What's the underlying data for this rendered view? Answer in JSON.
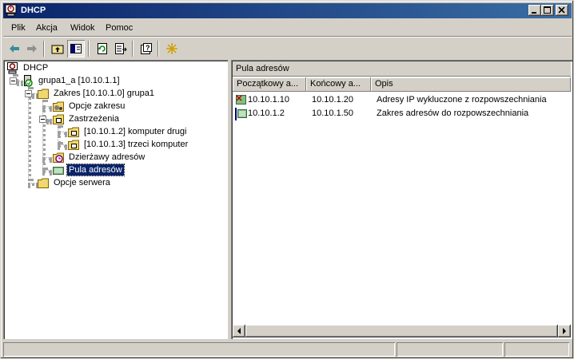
{
  "window": {
    "title": "DHCP",
    "controls": [
      "minimize",
      "maximize",
      "close"
    ]
  },
  "menu": {
    "items": [
      {
        "label": "Plik"
      },
      {
        "label": "Akcja"
      },
      {
        "label": "Widok"
      },
      {
        "label": "Pomoc"
      }
    ]
  },
  "toolbar": {
    "icons": [
      "back-arrow-icon",
      "forward-arrow-icon",
      "up-folder-icon",
      "show-hide-tree-icon",
      "refresh-icon",
      "export-list-icon",
      "help-icon",
      "new-scope-star-icon"
    ]
  },
  "tree": {
    "nodes": [
      {
        "label": "DHCP",
        "icon": "dhcp-console-icon"
      },
      {
        "label": "grupa1_a [10.10.1.1]",
        "icon": "server-icon"
      },
      {
        "label": "Zakres [10.10.1.0] grupa1",
        "icon": "folder-icon"
      },
      {
        "label": "Opcje zakresu",
        "icon": "options-folder-icon"
      },
      {
        "label": "Zastrzeżenia",
        "icon": "reservations-folder-icon"
      },
      {
        "label": "[10.10.1.2] komputer drugi",
        "icon": "reservation-icon"
      },
      {
        "label": "[10.10.1.3] trzeci komputer",
        "icon": "reservation-icon"
      },
      {
        "label": "Dzierżawy adresów",
        "icon": "leases-folder-icon"
      },
      {
        "label": "Pula adresów",
        "icon": "address-pool-icon",
        "selected": true
      },
      {
        "label": "Opcje serwera",
        "icon": "server-options-folder-icon"
      }
    ]
  },
  "detail": {
    "header": "Pula adresów",
    "columns": [
      "Początkowy a...",
      "Końcowy a...",
      "Opis"
    ],
    "rows": [
      {
        "start": "10.10.1.10",
        "end": "10.10.1.20",
        "desc": "Adresy IP wykluczone z rozpowszechniania",
        "icon": "exclusion-range-icon"
      },
      {
        "start": "10.10.1.2",
        "end": "10.10.1.50",
        "desc": "Zakres adresów do rozpowszechniania",
        "icon": "distribution-range-icon"
      }
    ]
  },
  "statusbar": {
    "panels": [
      "",
      "",
      "",
      ""
    ]
  }
}
